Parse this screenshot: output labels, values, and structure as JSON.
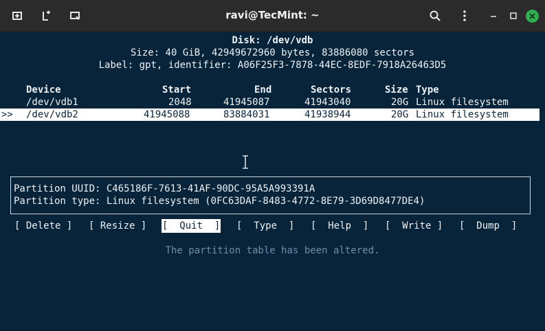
{
  "window": {
    "title": "ravi@TecMint: ~",
    "icons": [
      "new-tab-icon",
      "split-icon",
      "window-icon",
      "search-icon",
      "menu-icon",
      "minimize-icon",
      "maximize-icon",
      "close-icon"
    ]
  },
  "disk": {
    "header": "Disk: /dev/vdb",
    "size_line": "Size: 40 GiB, 42949672960 bytes, 83886080 sectors",
    "label_line": "Label: gpt, identifier: A06F25F3-7878-44EC-8EDF-7918A26463D5"
  },
  "table": {
    "columns": [
      "Device",
      "Start",
      "End",
      "Sectors",
      "Size",
      "Type"
    ],
    "rows": [
      {
        "marker": "",
        "device": "/dev/vdb1",
        "start": "2048",
        "end": "41945087",
        "sectors": "41943040",
        "size": "20G",
        "type": "Linux filesystem"
      },
      {
        "marker": ">>",
        "device": "/dev/vdb2",
        "start": "41945088",
        "end": "83884031",
        "sectors": "41938944",
        "size": "20G",
        "type": "Linux filesystem"
      }
    ]
  },
  "info": {
    "uuid_line": "Partition UUID: C465186F-7613-41AF-90DC-95A5A993391A",
    "type_line": "Partition type: Linux filesystem (0FC63DAF-8483-4772-8E79-3D69D8477DE4)"
  },
  "menu": {
    "delete": "[ Delete ]",
    "resize": "[ Resize ]",
    "quit": "[  Quit  ]",
    "type": "[  Type  ]",
    "help": "[  Help  ]",
    "write": "[  Write ]",
    "dump": "[  Dump  ]"
  },
  "status": "The partition table has been altered.",
  "colors": {
    "terminal_bg": "#07243a",
    "titlebar_bg": "#2b2b2b",
    "status_text": "#6f8fa9",
    "close_button": "#2fae4f"
  }
}
